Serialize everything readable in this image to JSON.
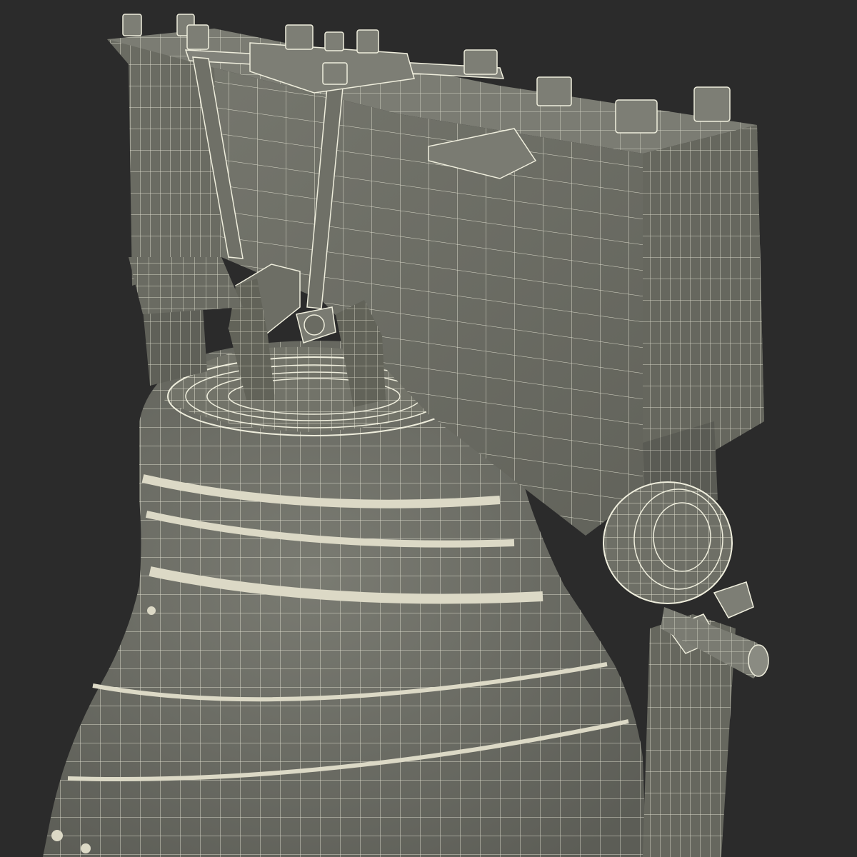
{
  "scene": {
    "subject": "wireframe-bell-model",
    "background_color": "#2b2b2b",
    "surface_color": "#6e6f66",
    "surface_shadow_color": "#4f5049",
    "surface_light_color": "#8a8b82",
    "wire_color": "#efeedd",
    "band_color": "#dcd9c6"
  }
}
